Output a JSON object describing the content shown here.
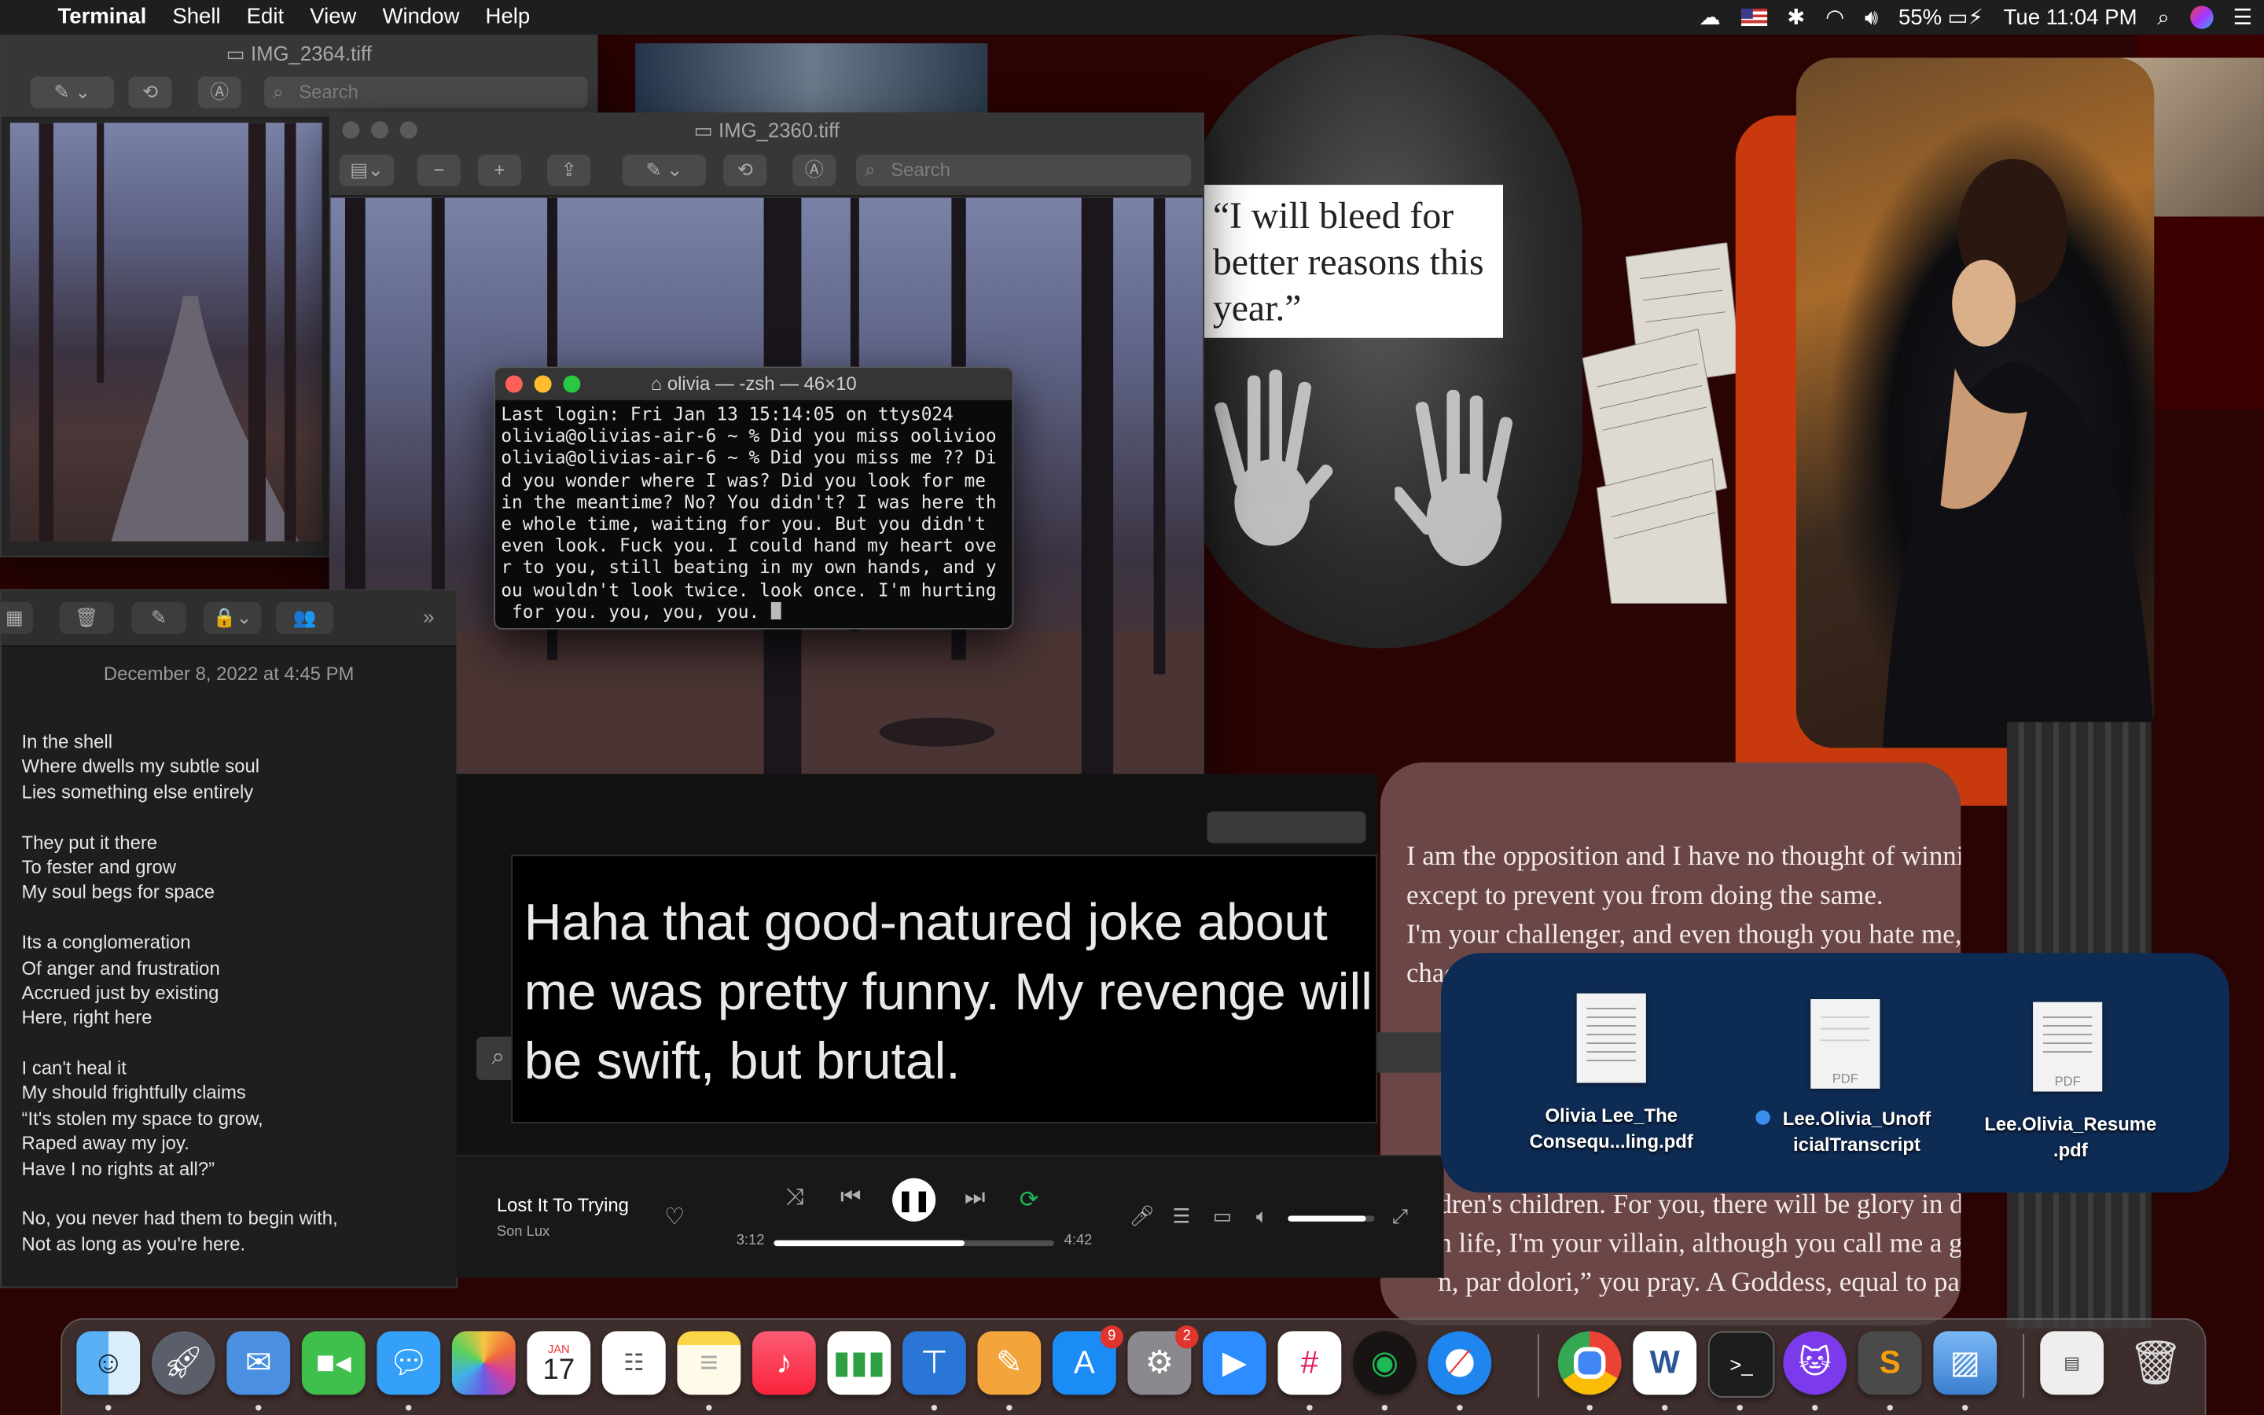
{
  "menubar": {
    "app_name": "Terminal",
    "menus": [
      "Shell",
      "Edit",
      "View",
      "Window",
      "Help"
    ],
    "battery": "55%",
    "clock": "Tue 11:04 PM"
  },
  "preview_back": {
    "title": "IMG_2364.tiff",
    "search_placeholder": "Search"
  },
  "preview_front": {
    "title": "IMG_2360.tiff",
    "search_placeholder": "Search"
  },
  "terminal": {
    "title": "olivia — -zsh — 46×10",
    "lines": [
      "Last login: Fri Jan 13 15:14:05 on ttys024",
      "olivia@olivias-air-6 ~ % Did you miss oolivioo",
      "olivia@olivias-air-6 ~ % Did you miss me ?? Di",
      "d you wonder where I was? Did you look for me",
      "in the meantime? No? You didn't? I was here th",
      "e whole time, waiting for you. But you didn't",
      "even look. Fuck you. I could hand my heart ove",
      "r to you, still beating in my own hands, and y",
      "ou wouldn't look twice. look once. I'm hurting",
      " for you. you, you, you. "
    ]
  },
  "notes": {
    "date": "December 8, 2022 at 4:45 PM",
    "stanzas": [
      [
        "In the shell",
        "Where dwells my subtle soul",
        "Lies something else entirely"
      ],
      [
        "They put it there",
        "To fester and grow",
        "My soul begs for space"
      ],
      [
        "Its a conglomeration",
        "Of anger and frustration",
        "Accrued just by existing",
        "Here, right here"
      ],
      [
        "I can't heal it",
        "My should frightfully claims",
        "“It's stolen my space to grow,",
        "Raped away my joy.",
        "Have I no rights at all?”"
      ],
      [
        "No, you never had them to begin with,",
        "Not as long as you're here."
      ]
    ]
  },
  "desktop_quote": "“I will bleed for better reasons this year.”",
  "poem_image": {
    "lines_top": [
      "I am the opposition and I have no thought of winning,",
      "except to prevent you from doing the same.",
      "I'm your challenger, and even though you hate me, my",
      "chaos"
    ],
    "lines_bottom": [
      "dren's children. For you, there will be glory in death.",
      "n life, I'm your villain, although you call me a god.",
      "n, par dolori,” you pray. A Goddess, equal to pain."
    ]
  },
  "tweet": {
    "text": "Haha that good-natured joke about me was pretty funny. My revenge will be swift, but brutal."
  },
  "spotify": {
    "track": "Lost It To Trying",
    "artist": "Son Lux",
    "elapsed": "3:12",
    "duration": "4:42",
    "progress_fraction": 0.68,
    "volume_fraction": 0.9
  },
  "desktop_files": [
    {
      "name": "Olivia Lee_The Consequ...ling.pdf",
      "tag_dot": false
    },
    {
      "name": "Lee.Olivia_Unofficial Transcript",
      "tag_dot": true
    },
    {
      "name": "Lee.Olivia_Resume .pdf",
      "tag_dot": false
    }
  ],
  "file_labels": {
    "f0_l1": "Olivia Lee_The",
    "f0_l2": "Consequ...ling.pdf",
    "f1_l1": "Lee.Olivia_Unoff",
    "f1_l2": "icialTranscript",
    "f2_l1": "Lee.Olivia_Resume",
    "f2_l2": ".pdf",
    "pdf_tag": "PDF"
  },
  "dock": {
    "calendar_month": "JAN",
    "calendar_day": "17",
    "appstore_badge": "9",
    "settings_badge": "2",
    "items": [
      "finder-icon",
      "launchpad-icon",
      "mail-icon",
      "facetime-icon",
      "messages-icon",
      "photos-icon",
      "calendar-icon",
      "reminders-icon",
      "notes-icon",
      "music-icon",
      "numbers-icon",
      "keynote-icon",
      "pages-icon",
      "app-store-icon",
      "system-preferences-icon",
      "zoom-icon",
      "slack-icon",
      "spotify-icon",
      "safari-icon",
      "chrome-icon",
      "word-icon",
      "terminal-icon",
      "github-desktop-icon",
      "sublime-text-icon",
      "preview-icon",
      "downloads-stack-icon",
      "trash-icon"
    ]
  },
  "colors": {
    "accent_blue": "#0e2b54",
    "orange": "#c83a0e",
    "spotify_green": "#1db954"
  }
}
